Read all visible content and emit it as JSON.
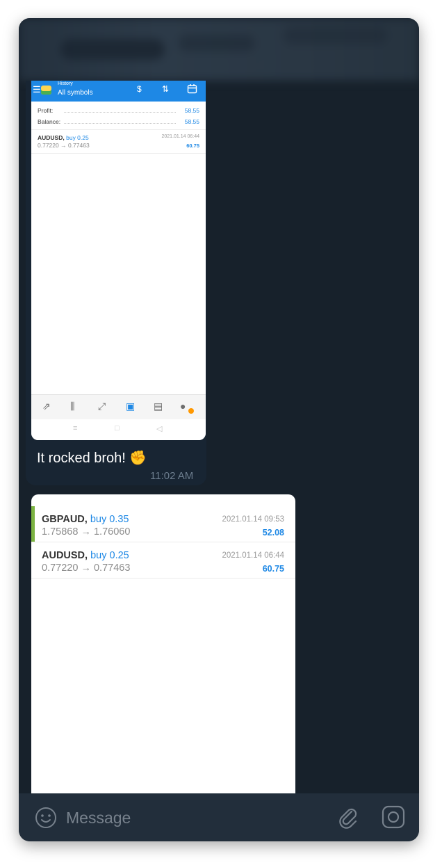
{
  "mt_history": {
    "screen_title": "History",
    "filter": "All symbols",
    "summary": [
      {
        "label": "Profit:",
        "value": "58.55"
      },
      {
        "label": "Balance:",
        "value": "58.55"
      }
    ],
    "deal": {
      "symbol": "AUDUSD,",
      "direction": "buy 0.25",
      "prices": "0.77220 → 0.77463",
      "datetime": "2021.01.14 06:44",
      "profit": "60.75"
    }
  },
  "message1": {
    "caption": "It rocked broh! ✊",
    "time": "11:02 AM"
  },
  "message2": {
    "deals": [
      {
        "symbol": "GBPAUD,",
        "direction": "buy 0.35",
        "prices": "1.75868 → 1.76060",
        "datetime": "2021.01.14 09:53",
        "profit": "52.08"
      },
      {
        "symbol": "AUDUSD,",
        "direction": "buy 0.25",
        "prices": "0.77220 → 0.77463",
        "datetime": "2021.01.14 06:44",
        "profit": "60.75"
      }
    ]
  },
  "input": {
    "placeholder": "Message"
  },
  "icons": {
    "menu": "menu-icon",
    "deposit": "deposit-icon",
    "sort": "sort-icon",
    "calendar": "calendar-icon",
    "quotes": "quotes-icon",
    "chart": "chart-icon",
    "trade": "trade-icon",
    "history": "history-icon",
    "news": "news-icon",
    "chat": "chat-icon",
    "emoji": "emoji-icon",
    "attach": "paperclip-icon",
    "camera": "camera-icon"
  },
  "colors": {
    "chat_background": "#17212b",
    "input_bar": "#222e3b",
    "mt_accent": "#1e88e5",
    "buy_marker": "#7cb342",
    "timestamp": "#6c7d8e"
  }
}
